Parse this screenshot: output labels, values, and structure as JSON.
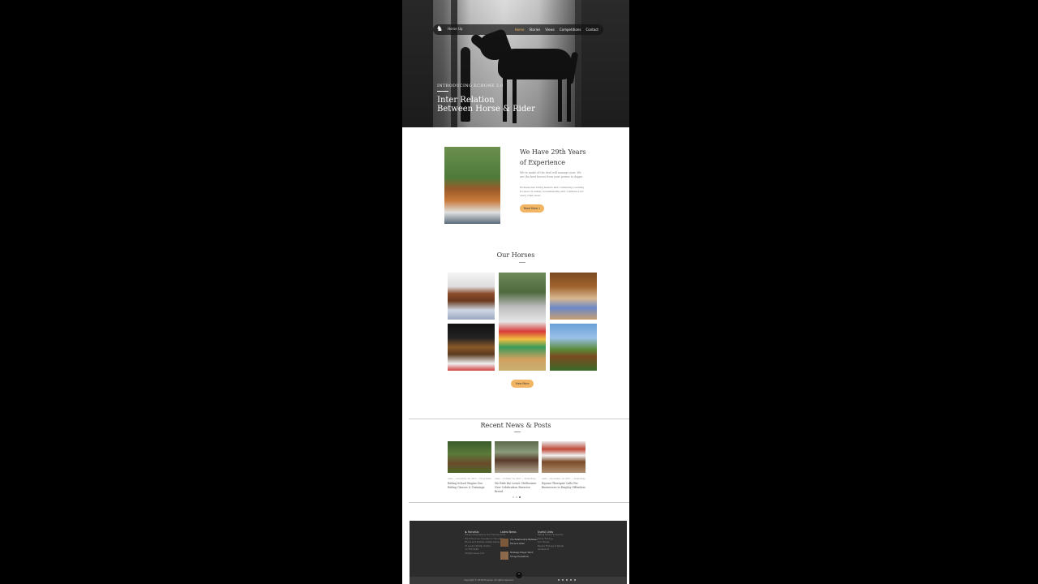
{
  "hero": {
    "logo_text": "Horse Up",
    "nav": [
      "Home",
      "Stories",
      "Views",
      "Competitions",
      "Contact"
    ],
    "kicker": "INTRODUCING ECHONE 3.0",
    "title_line1": "Inter Relation",
    "title_line2": "Between Horse & Rider"
  },
  "experience": {
    "title_line1": "We Have 29th Years",
    "title_line2": "of Experience",
    "para1": "We've made of the deal will manage your. We are the best horses from your ponies to doppe.",
    "para2": "Professional riding lessons and continuing coaching focused on safety, horsemanship and confidence for every rider level.",
    "button": "Read More"
  },
  "horses": {
    "title": "Our Horses",
    "button": "View More"
  },
  "news": {
    "title": "Recent News & Posts",
    "posts": [
      {
        "meta": "news — December 20, 2017 — Fiona Parks",
        "title": "Riding School Begins Our Riding Classes & Trainings"
      },
      {
        "meta": "news — October 14, 2017 — Sarah Riley",
        "title": "We Ride the Lower Chilbourne New Celebration Exercise Breed"
      },
      {
        "meta": "news — November 14, 2017 — Sarah Riley",
        "title": "Equine Therapist Calls For Businesses to Employ Offenders"
      }
    ]
  },
  "footer": {
    "col1_head": "HorseUp",
    "col1_lines": [
      "Horse riding lessons and training since",
      "the time of our founders in the valley.",
      "Phone and address details below.",
      "27 Lucern Street, Hoxton",
      "+1 555 0184",
      "info@horseup.com"
    ],
    "col2_head": "Latest News",
    "col2_items": [
      "The Relationship Between Horse & Rider",
      "Strategic Player Word: Things Equestrian"
    ],
    "col3_head": "Useful Links",
    "col3_lines": [
      "Riding School & Lessons",
      "Horse Training",
      "Our Horses",
      "Equine Therapy & Rehab",
      "Contact Us"
    ],
    "copyright": "Copyright © 2018 HorseUp. All rights reserved."
  }
}
